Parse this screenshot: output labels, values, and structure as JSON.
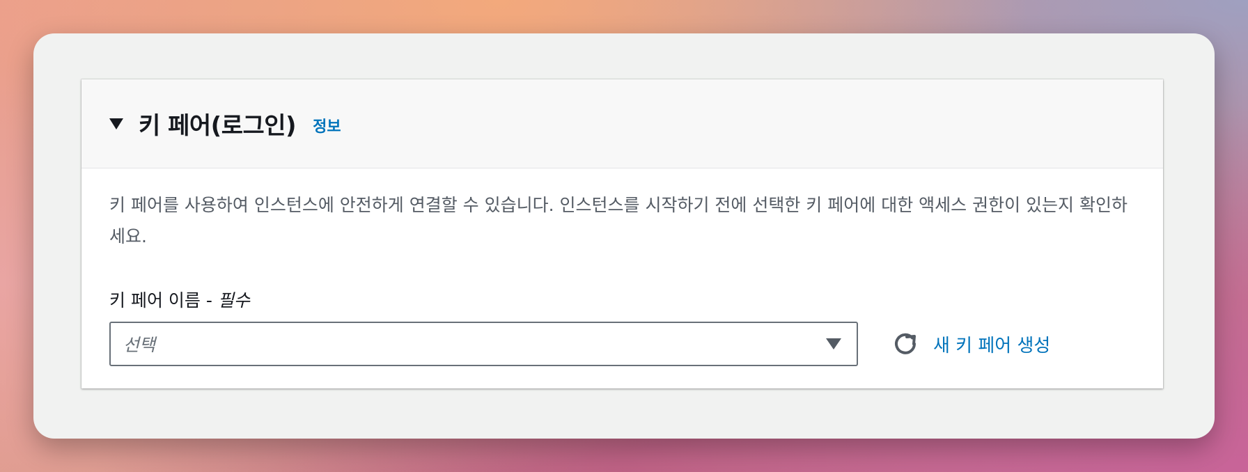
{
  "section": {
    "title": "키 페어(로그인)",
    "info_link": "정보",
    "description": "키 페어를 사용하여 인스턴스에 안전하게 연결할 수 있습니다. 인스턴스를 시작하기 전에 선택한 키 페어에 대한 액세스 권한이 있는지 확인하세요."
  },
  "key_pair_field": {
    "label": "키 페어 이름 - ",
    "required_label": "필수",
    "placeholder": "선택"
  },
  "actions": {
    "create_new_label": "새 키 페어 생성"
  },
  "icons": {
    "collapse": "caret-down-icon",
    "dropdown": "caret-down-icon",
    "refresh": "refresh-icon"
  },
  "colors": {
    "link": "#0073bb",
    "title": "#16191f",
    "body_text": "#545b64"
  }
}
